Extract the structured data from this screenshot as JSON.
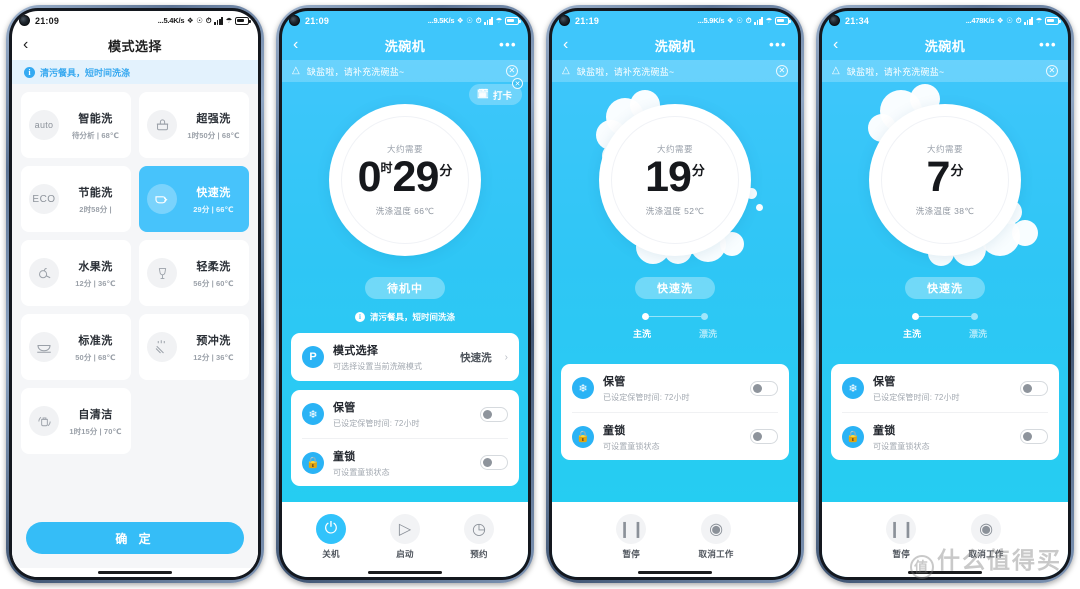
{
  "phones": [
    {
      "id": "mode-select",
      "theme": "dark",
      "status": {
        "time": "21:09",
        "speed": "...5.4K/s",
        "icons": [
          "bluetooth-icon",
          "mute-icon",
          "alarm-icon",
          "signal-icon",
          "wifi-icon",
          "battery-icon"
        ]
      },
      "appbar": {
        "back": "‹",
        "title": "模式选择",
        "menu": "•••"
      },
      "tip": "清污餐具，短时间洗涤",
      "modes": [
        {
          "name": "智能洗",
          "sub": "待分析 | 68℃",
          "icon": "auto",
          "active": false
        },
        {
          "name": "超强洗",
          "sub": "1时50分 | 68℃",
          "icon": "pot",
          "active": false
        },
        {
          "name": "节能洗",
          "sub": "2时58分 |",
          "icon": "eco",
          "active": false
        },
        {
          "name": "快速洗",
          "sub": "29分 | 66℃",
          "icon": "fast",
          "active": true
        },
        {
          "name": "水果洗",
          "sub": "12分 | 36℃",
          "icon": "fruit",
          "active": false
        },
        {
          "name": "轻柔洗",
          "sub": "56分 | 60℃",
          "icon": "glass",
          "active": false
        },
        {
          "name": "标准洗",
          "sub": "50分 | 68℃",
          "icon": "bowl",
          "active": false
        },
        {
          "name": "预冲洗",
          "sub": "12分 | 36℃",
          "icon": "rinse",
          "active": false
        },
        {
          "name": "自清洁",
          "sub": "1时15分 | 70℃",
          "icon": "selfclean",
          "active": false
        }
      ],
      "confirm": "确 定"
    },
    {
      "id": "standby",
      "theme": "light",
      "status": {
        "time": "21:09",
        "speed": "...9.5K/s"
      },
      "appbar": {
        "back": "‹",
        "title": "洗碗机",
        "menu": "•••"
      },
      "warning": "缺盐啦，请补充洗碗盐~",
      "checkin": "打卡",
      "dial": {
        "top": "大约需要",
        "hours": "0",
        "hour_unit": "时",
        "minutes": "29",
        "minute_unit": "分",
        "temp": "洗涤温度 66℃"
      },
      "state": "待机中",
      "tip": "清污餐具，短时间洗涤",
      "rows": [
        {
          "icon": "P",
          "name": "模式选择",
          "sub": "可选择设置当前洗碗模式",
          "value": "快速洗",
          "kind": "nav"
        },
        {
          "icon": "❄",
          "name": "保管",
          "sub": "已设定保管时间: 72小时",
          "kind": "toggle",
          "on": false
        },
        {
          "icon": "🔒",
          "name": "童锁",
          "sub": "可设置童锁状态",
          "kind": "toggle",
          "on": false
        }
      ],
      "bottom": [
        {
          "label": "关机",
          "icon": "power",
          "active": true
        },
        {
          "label": "启动",
          "icon": "play",
          "active": false
        },
        {
          "label": "预约",
          "icon": "clock",
          "active": false
        }
      ]
    },
    {
      "id": "running-19",
      "theme": "light",
      "status": {
        "time": "21:19",
        "speed": "...5.9K/s"
      },
      "appbar": {
        "back": "‹",
        "title": "洗碗机",
        "menu": "•••"
      },
      "warning": "缺盐啦，请补充洗碗盐~",
      "dial": {
        "top": "大约需要",
        "minutes": "19",
        "minute_unit": "分",
        "temp": "洗涤温度 52℃"
      },
      "state": "快速洗",
      "steps": [
        {
          "label": "主洗",
          "active": true
        },
        {
          "label": "漂洗",
          "active": false
        }
      ],
      "rows": [
        {
          "icon": "❄",
          "name": "保管",
          "sub": "已设定保管时间: 72小时",
          "kind": "toggle",
          "on": false
        },
        {
          "icon": "🔒",
          "name": "童锁",
          "sub": "可设置童锁状态",
          "kind": "toggle",
          "on": false
        }
      ],
      "bottom": [
        {
          "label": "暂停",
          "icon": "pause",
          "active": false
        },
        {
          "label": "取消工作",
          "icon": "stop",
          "active": false
        }
      ]
    },
    {
      "id": "running-7",
      "theme": "light",
      "status": {
        "time": "21:34",
        "speed": "...478K/s"
      },
      "appbar": {
        "back": "‹",
        "title": "洗碗机",
        "menu": "•••"
      },
      "warning": "缺盐啦，请补充洗碗盐~",
      "dial": {
        "top": "大约需要",
        "minutes": "7",
        "minute_unit": "分",
        "temp": "洗涤温度 38℃"
      },
      "state": "快速洗",
      "steps": [
        {
          "label": "主洗",
          "active": true
        },
        {
          "label": "漂洗",
          "active": false
        }
      ],
      "rows": [
        {
          "icon": "❄",
          "name": "保管",
          "sub": "已设定保管时间: 72小时",
          "kind": "toggle",
          "on": false
        },
        {
          "icon": "🔒",
          "name": "童锁",
          "sub": "可设置童锁状态",
          "kind": "toggle",
          "on": false
        }
      ],
      "bottom": [
        {
          "label": "暂停",
          "icon": "pause",
          "active": false
        },
        {
          "label": "取消工作",
          "icon": "stop",
          "active": false
        }
      ]
    }
  ],
  "watermark": "什么值得买",
  "watermark_badge": "值",
  "colors": {
    "accent": "#35bdf7",
    "screen_bg": "#3fc6fb",
    "card": "#ffffff",
    "tip_bg": "#e3f2fd"
  }
}
